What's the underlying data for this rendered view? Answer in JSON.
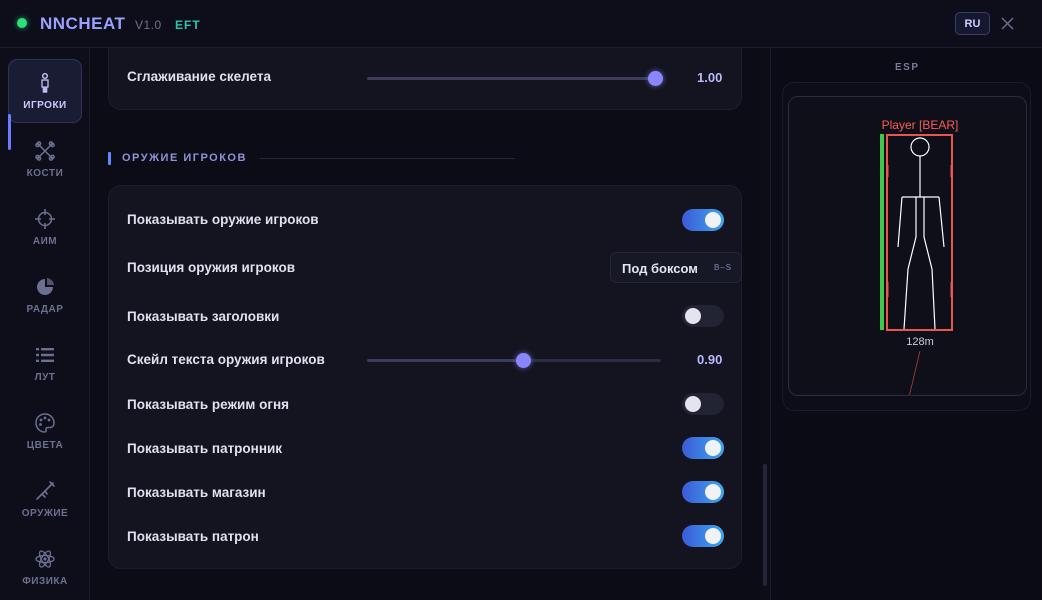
{
  "header": {
    "title": "NNCHEAT",
    "version": "V1.0",
    "game": "EFT",
    "language": "RU"
  },
  "sidebar": {
    "items": [
      {
        "label": "ИГРОКИ",
        "icon": "player-icon",
        "active": true
      },
      {
        "label": "КОСТИ",
        "icon": "bones-icon",
        "active": false
      },
      {
        "label": "АИМ",
        "icon": "crosshair-icon",
        "active": false
      },
      {
        "label": "РАДАР",
        "icon": "radar-icon",
        "active": false
      },
      {
        "label": "ЛУТ",
        "icon": "list-icon",
        "active": false
      },
      {
        "label": "ЦВЕТА",
        "icon": "palette-icon",
        "active": false
      },
      {
        "label": "ОРУЖИЕ",
        "icon": "rifle-icon",
        "active": false
      },
      {
        "label": "ФИЗИКА",
        "icon": "atom-icon",
        "active": false
      }
    ]
  },
  "top_card": {
    "label": "Сглаживание скелета",
    "value": "1.00",
    "level": 1.0
  },
  "weapons_section": {
    "title": "ОРУЖИЕ ИГРОКОВ",
    "rows": [
      {
        "type": "toggle",
        "label": "Показывать оружие игроков",
        "on": true
      },
      {
        "type": "dropdown",
        "label": "Позиция оружия игроков",
        "value": "Под боксом",
        "tag": "B–S"
      },
      {
        "type": "toggle",
        "label": "Показывать заголовки",
        "on": false
      },
      {
        "type": "slider",
        "label": "Скейл текста оружия игроков",
        "value": "0.90",
        "level": 0.53
      },
      {
        "type": "toggle",
        "label": "Показывать режим огня",
        "on": false
      },
      {
        "type": "toggle",
        "label": "Показывать патронник",
        "on": true
      },
      {
        "type": "toggle",
        "label": "Показывать магазин",
        "on": true
      },
      {
        "type": "toggle",
        "label": "Показывать патрон",
        "on": true
      }
    ]
  },
  "esp": {
    "title": "ESP",
    "player_label": "Player [BEAR]",
    "distance": "128m",
    "health_level": 1.0,
    "colors": {
      "box": "#e8564f",
      "health": "#3ec94a",
      "skeleton": "#ffffff"
    }
  },
  "colors": {
    "accent": "#8a86ff",
    "toggle_on": "#3b8ee6",
    "status": "#2ee07a",
    "game_tag": "#27c5a8"
  }
}
